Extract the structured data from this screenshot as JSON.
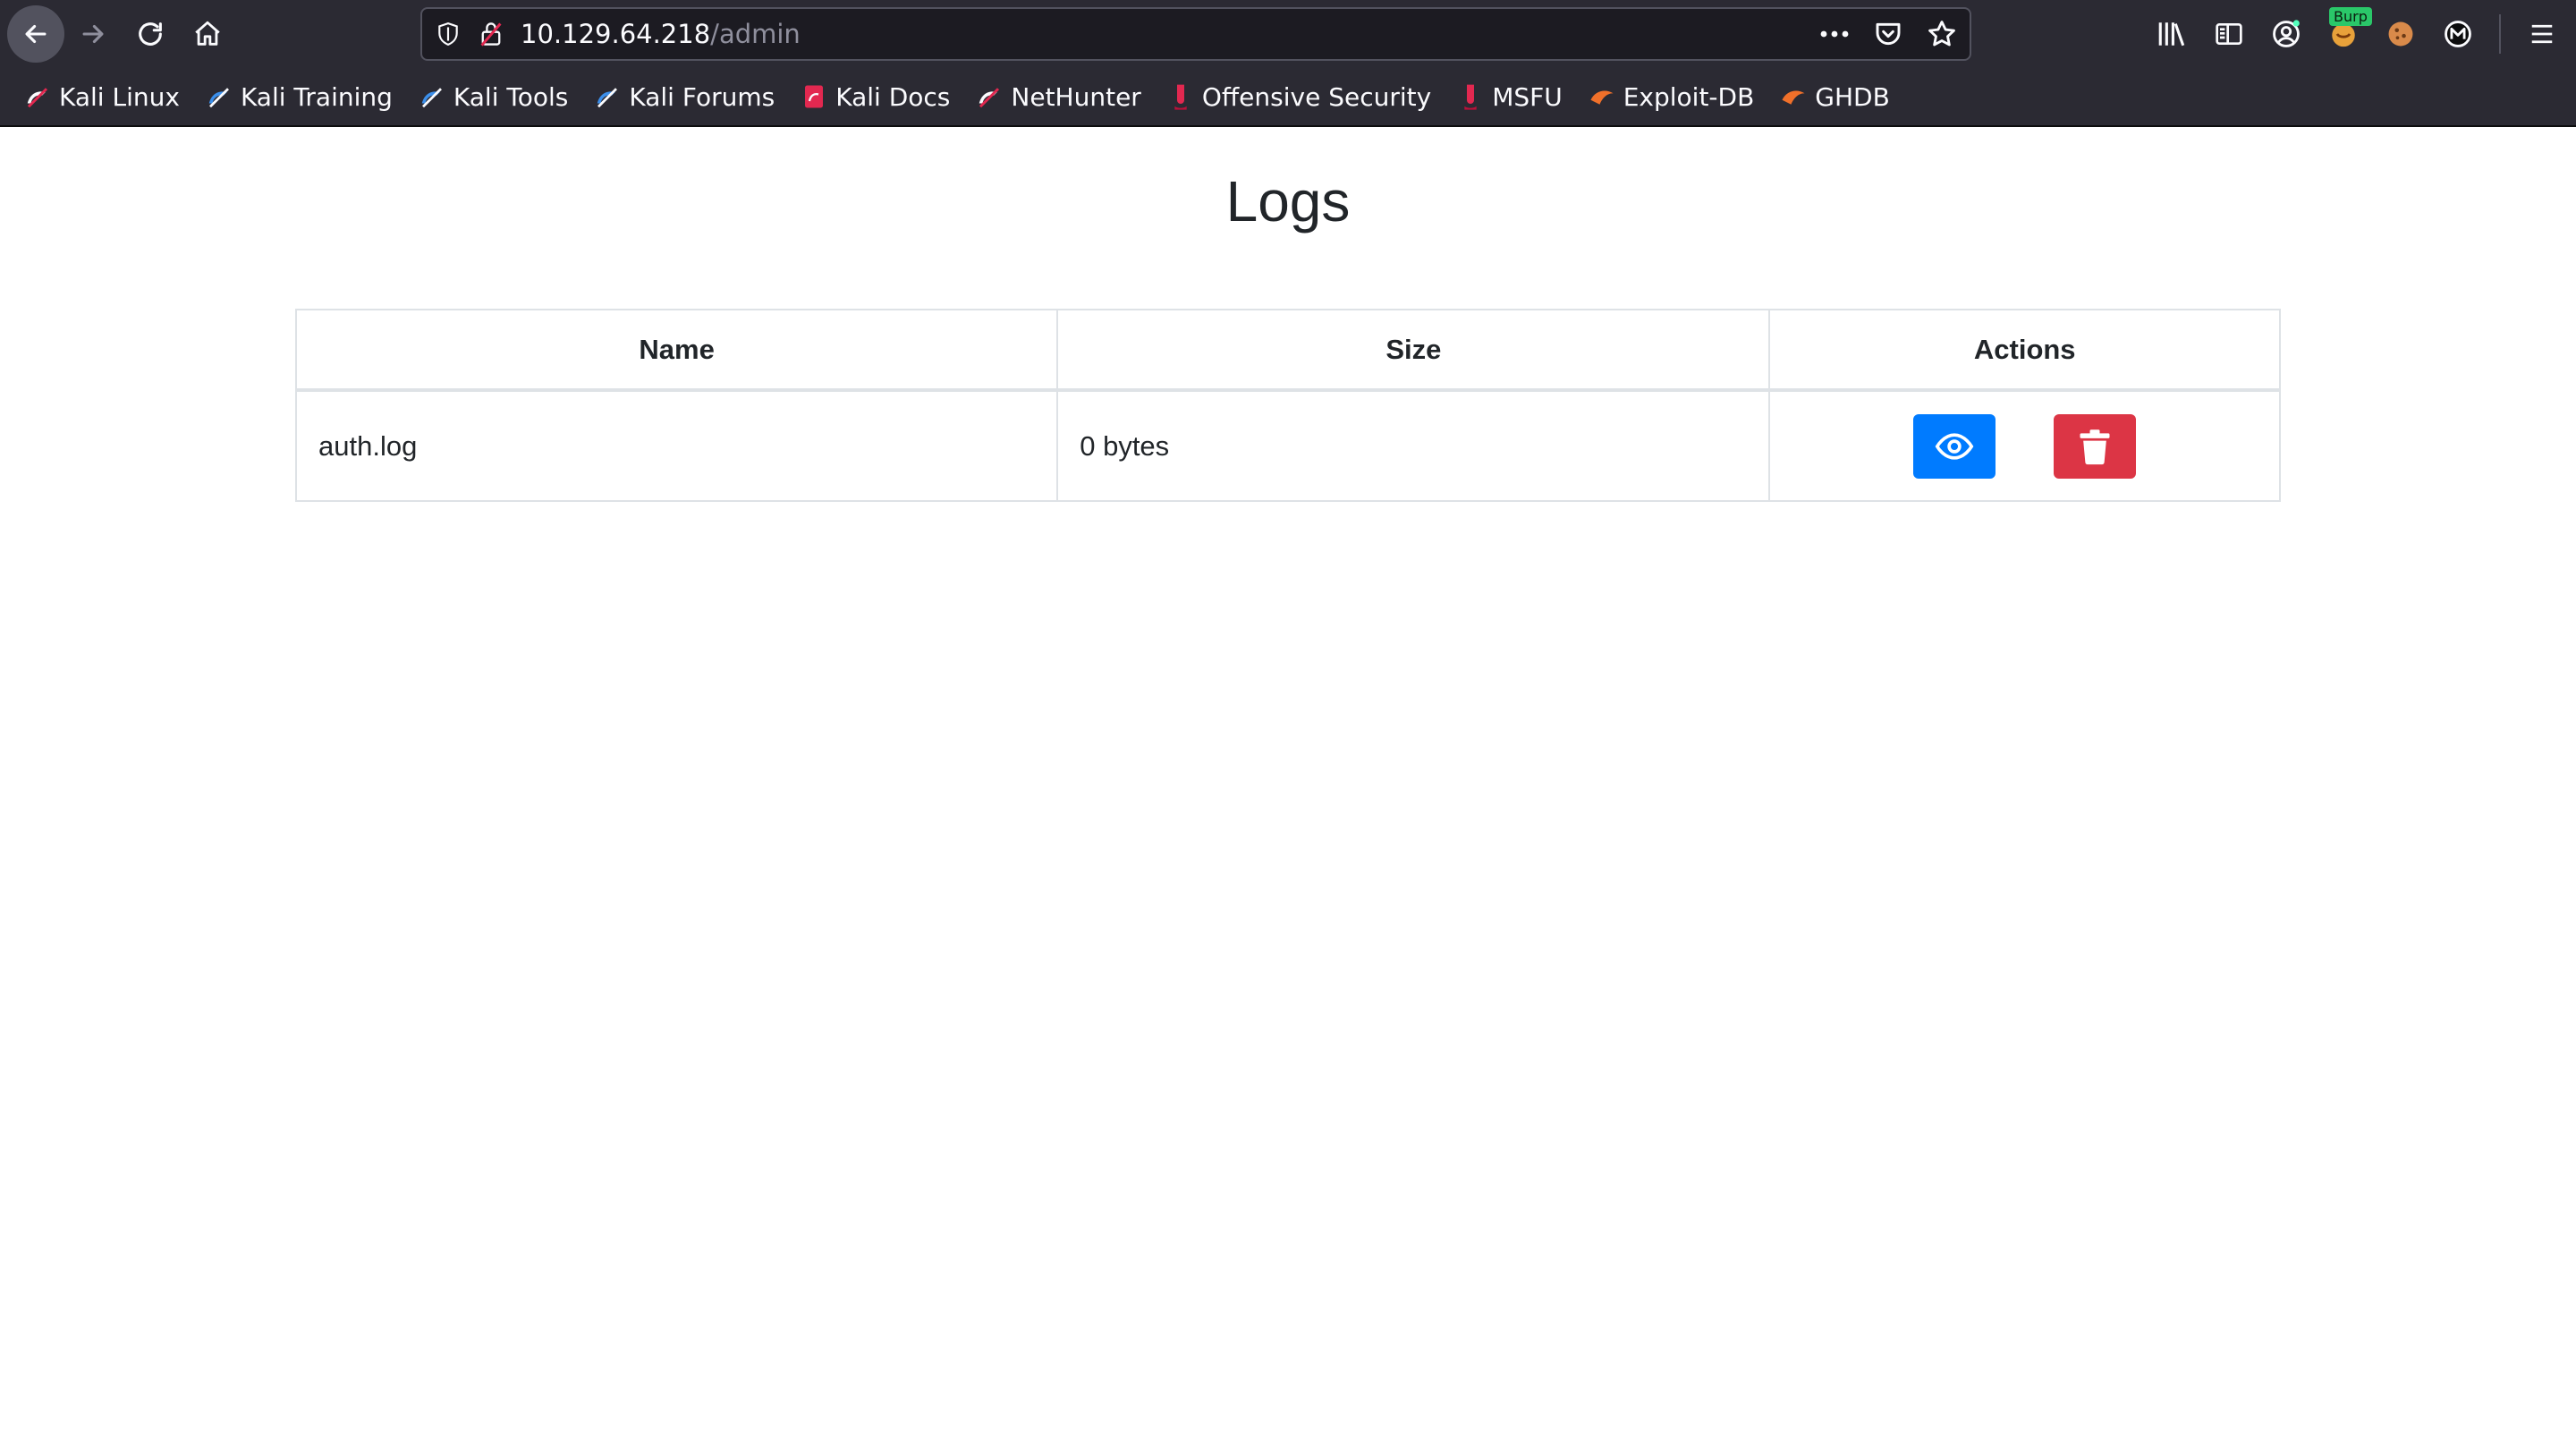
{
  "browser": {
    "url_host": "10.129.64.218",
    "url_path": "/admin",
    "burp_badge": "Burp",
    "bookmarks": [
      {
        "label": "Kali Linux",
        "icon": "kali-dragon-icon"
      },
      {
        "label": "Kali Training",
        "icon": "kali-training-icon"
      },
      {
        "label": "Kali Tools",
        "icon": "kali-tools-icon"
      },
      {
        "label": "Kali Forums",
        "icon": "kali-forums-icon"
      },
      {
        "label": "Kali Docs",
        "icon": "kali-docs-icon"
      },
      {
        "label": "NetHunter",
        "icon": "nethunter-icon"
      },
      {
        "label": "Offensive Security",
        "icon": "offsec-icon"
      },
      {
        "label": "MSFU",
        "icon": "msfu-icon"
      },
      {
        "label": "Exploit-DB",
        "icon": "exploit-db-icon"
      },
      {
        "label": "GHDB",
        "icon": "ghdb-icon"
      }
    ]
  },
  "page": {
    "title": "Logs",
    "table": {
      "headers": [
        "Name",
        "Size",
        "Actions"
      ],
      "rows": [
        {
          "name": "auth.log",
          "size": "0 bytes"
        }
      ]
    }
  },
  "colors": {
    "view_button": "#007bff",
    "delete_button": "#dc3545",
    "chrome_bg": "#2b2a33"
  }
}
